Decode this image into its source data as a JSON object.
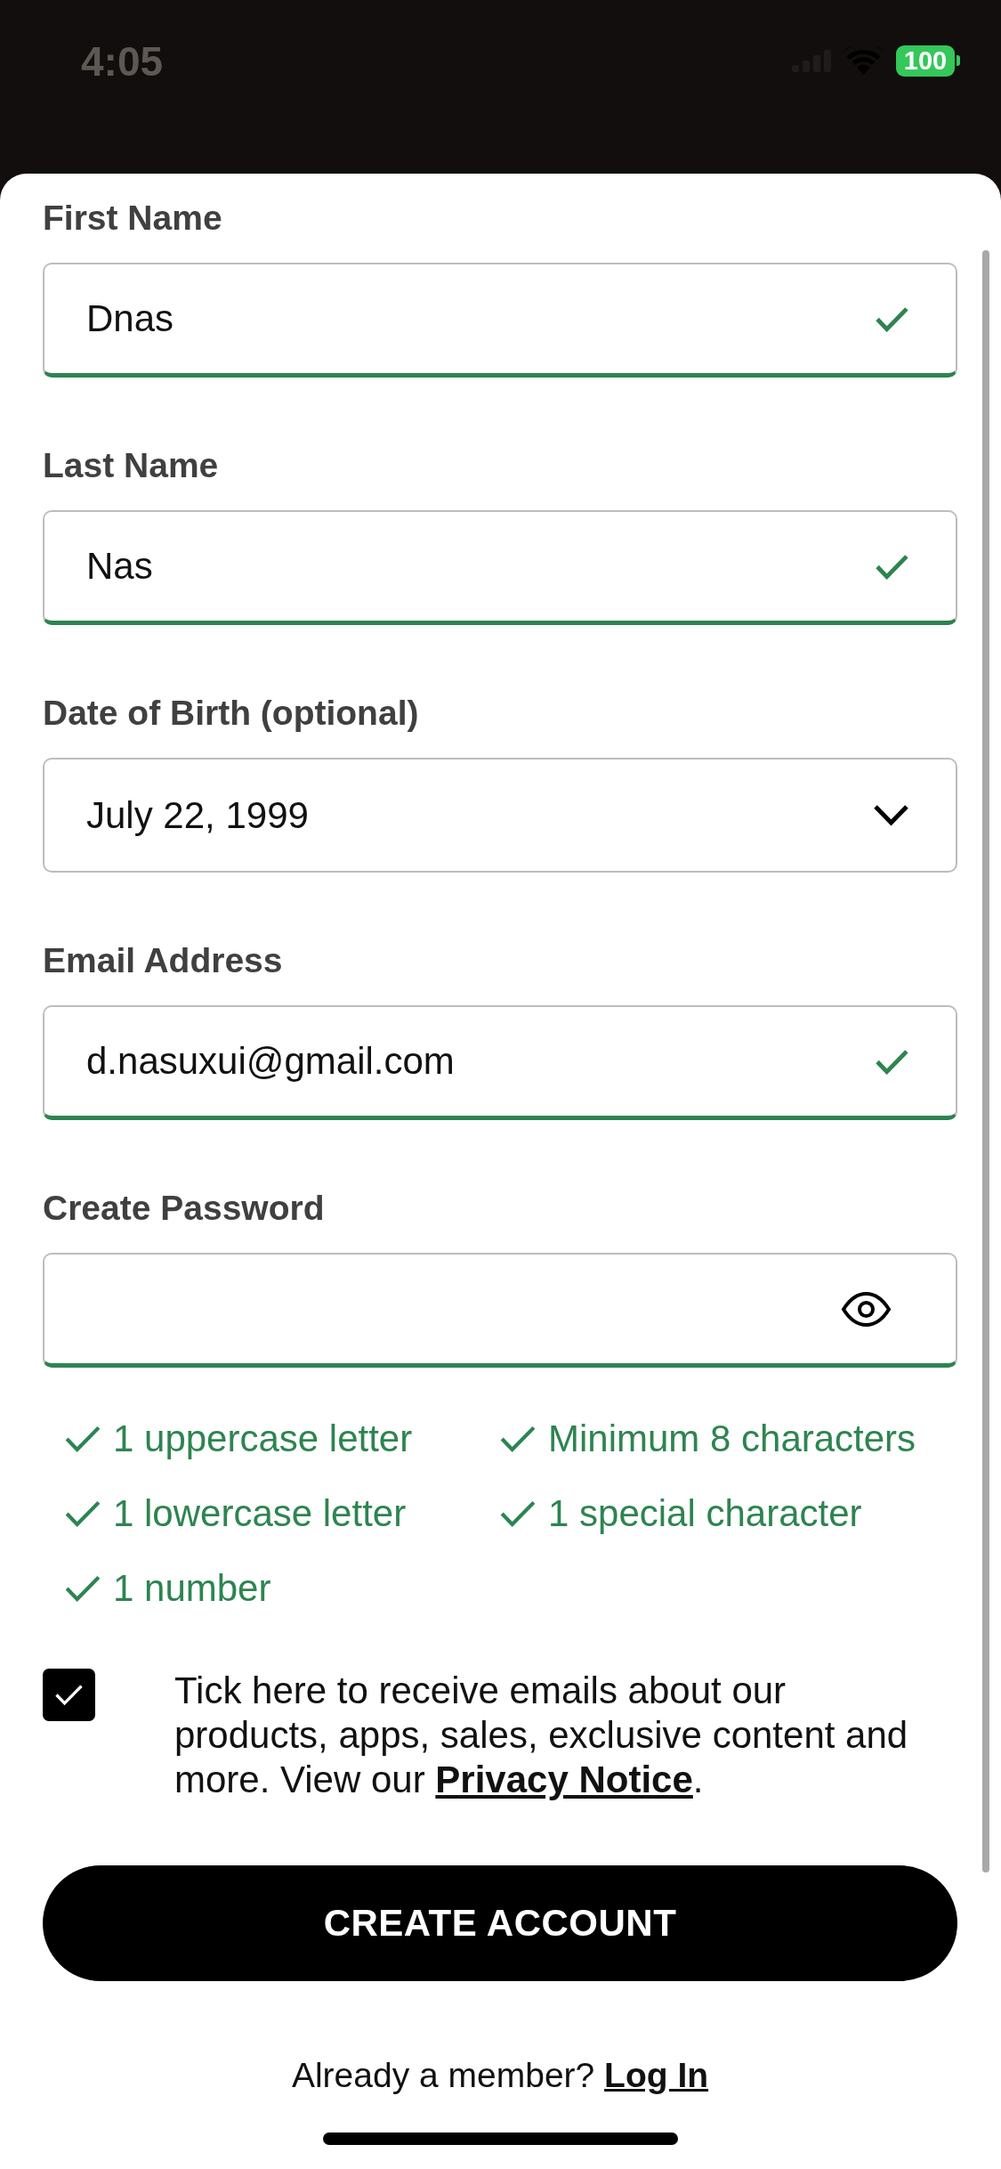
{
  "status_bar": {
    "time": "4:05",
    "battery": "100"
  },
  "fields": [
    {
      "kind": "text",
      "label": "First Name",
      "value": "Dnas",
      "valid": true
    },
    {
      "kind": "text",
      "label": "Last Name",
      "value": "Nas",
      "valid": true
    },
    {
      "kind": "date",
      "label": "Date of Birth (optional)",
      "value": "July 22, 1999",
      "valid": false
    },
    {
      "kind": "text",
      "label": "Email Address",
      "value": "d.nasuxui@gmail.com",
      "valid": true
    },
    {
      "kind": "password",
      "label": "Create Password",
      "valid": true
    }
  ],
  "password_rules": [
    {
      "text": "1 uppercase letter",
      "met": true
    },
    {
      "text": "Minimum 8 characters",
      "met": true
    },
    {
      "text": "1 lowercase letter",
      "met": true
    },
    {
      "text": "1 special character",
      "met": true
    },
    {
      "text": "1 number",
      "met": true
    }
  ],
  "marketing_consent": {
    "checked": true,
    "text": "Tick here to receive emails about our products, apps, sales, exclusive content and more. View our ",
    "link": "Privacy Notice",
    "text_after": "."
  },
  "submit_button": {
    "label": "CREATE ACCOUNT"
  },
  "login_prompt": {
    "text": "Already a member? ",
    "link": "Log In"
  }
}
